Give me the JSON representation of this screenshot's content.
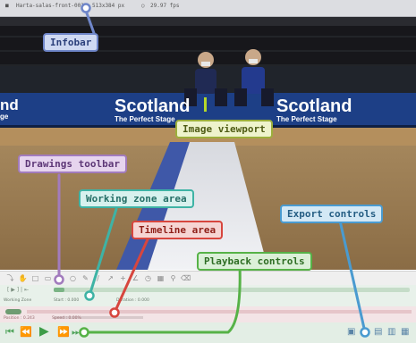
{
  "infobar": {
    "filename": "Harta-salas-front-0012",
    "resolution": "513x384 px",
    "fps": "29.97 fps"
  },
  "video": {
    "banner_texts": [
      {
        "line1": "Scotland",
        "line2": "The Perfect Stage"
      },
      {
        "line1": "Scotland",
        "line2": "The Perfect Stage"
      }
    ],
    "left_banner_fragment": {
      "line1": "nd",
      "line2": "ge"
    }
  },
  "working_zone": {
    "start_label": "Start : 0.000",
    "duration_label": "Duration : 0.000",
    "caption": "Working Zone"
  },
  "timeline": {
    "position_label": "Position : 0.243",
    "speed_label": "Speed : 0.00%"
  },
  "callouts": {
    "infobar": "Infobar",
    "image_viewport": "Image viewport",
    "drawings_toolbar": "Drawings toolbar",
    "working_zone_area": "Working zone area",
    "timeline_area": "Timeline area",
    "playback_controls": "Playback controls",
    "export_controls": "Export controls"
  },
  "colors": {
    "infobar": "#6f86c9",
    "drawings": "#a27bbd",
    "working_zone": "#3eb3a5",
    "timeline": "#d7463e",
    "playback": "#56b247",
    "export": "#4a9bd0",
    "viewport": "#9caf3c"
  },
  "icons": {
    "playback": [
      "first-frame-icon",
      "previous-frame-icon",
      "play-icon",
      "next-frame-icon",
      "last-frame-icon"
    ],
    "export": [
      "snapshot-icon",
      "export-video-icon",
      "export-image-icon",
      "export-images-icon",
      "export-diff-icon"
    ]
  }
}
